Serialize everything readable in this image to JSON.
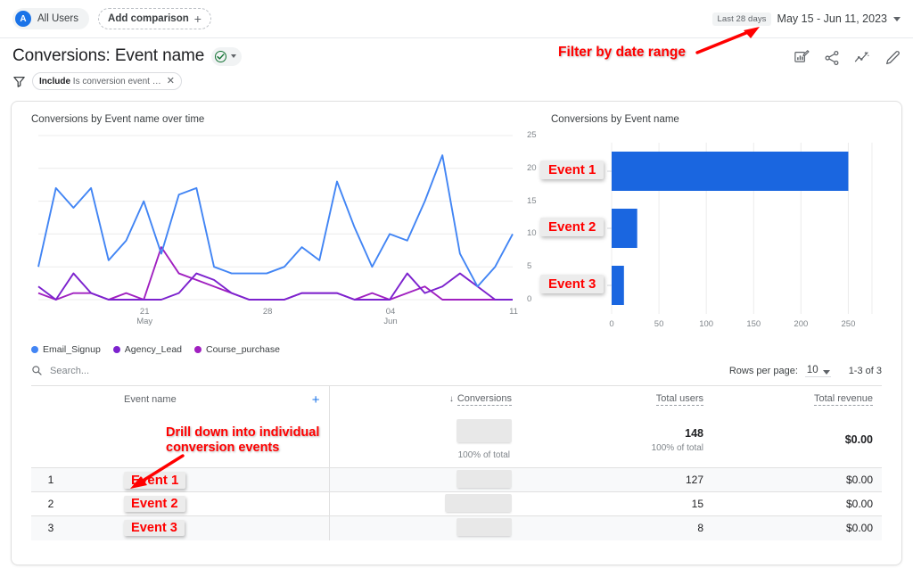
{
  "topbar": {
    "audience_initial": "A",
    "audience_label": "All Users",
    "add_comparison_label": "Add comparison",
    "last_days_badge": "Last 28 days",
    "date_range": "May 15 - Jun 11, 2023"
  },
  "header": {
    "title": "Conversions: Event name",
    "filter_chip_prefix": "Include",
    "filter_chip_text": "Is conversion event …",
    "icons": [
      "insights-icon",
      "share-icon",
      "compare-icon",
      "edit-icon"
    ]
  },
  "annotations": {
    "date_filter": "Filter by date range",
    "drill_down_line1": "Drill down into individual",
    "drill_down_line2": "conversion events",
    "bar_labels": [
      "Event 1",
      "Event 2",
      "Event 3"
    ],
    "row_labels": [
      "Event 1",
      "Event 2",
      "Event 3"
    ],
    "color": "#ff0000"
  },
  "chart_data": [
    {
      "type": "line",
      "title": "Conversions by Event name over time",
      "xlabel": "",
      "ylabel": "",
      "ylim": [
        0,
        25
      ],
      "yticks": [
        0,
        5,
        10,
        15,
        20,
        25
      ],
      "grid": true,
      "legend_position": "bottom-left",
      "x_tick_labels": [
        "21\nMay",
        "28",
        "04\nJun",
        "11"
      ],
      "x_tick_indices": [
        6,
        13,
        20,
        27
      ],
      "x": [
        "May 15",
        "May 16",
        "May 17",
        "May 18",
        "May 19",
        "May 20",
        "May 21",
        "May 22",
        "May 23",
        "May 24",
        "May 25",
        "May 26",
        "May 27",
        "May 28",
        "May 29",
        "May 30",
        "May 31",
        "Jun 01",
        "Jun 02",
        "Jun 03",
        "Jun 04",
        "Jun 05",
        "Jun 06",
        "Jun 07",
        "Jun 08",
        "Jun 09",
        "Jun 10",
        "Jun 11"
      ],
      "series": [
        {
          "name": "Email_Signup",
          "color": "#4285f4",
          "values": [
            5,
            17,
            14,
            17,
            6,
            9,
            15,
            7,
            16,
            17,
            5,
            4,
            4,
            4,
            5,
            8,
            6,
            18,
            11,
            5,
            10,
            9,
            15,
            22,
            7,
            2,
            5,
            10
          ]
        },
        {
          "name": "Agency_Lead",
          "color": "#7c22ce",
          "values": [
            2,
            0,
            4,
            1,
            0,
            0,
            0,
            0,
            1,
            4,
            3,
            1,
            0,
            0,
            0,
            1,
            1,
            1,
            0,
            0,
            0,
            4,
            1,
            2,
            4,
            2,
            0,
            0
          ]
        },
        {
          "name": "Course_purchase",
          "color": "#a020c0",
          "values": [
            1,
            0,
            1,
            1,
            0,
            1,
            0,
            8,
            4,
            3,
            2,
            1,
            0,
            0,
            0,
            1,
            1,
            1,
            0,
            1,
            0,
            1,
            2,
            0,
            0,
            0,
            0,
            0
          ]
        }
      ]
    },
    {
      "type": "bar",
      "orientation": "horizontal",
      "title": "Conversions by Event name",
      "categories": [
        "Event 1",
        "Event 2",
        "Event 3"
      ],
      "values": [
        250,
        27,
        13
      ],
      "bar_color": "#1a66e0",
      "xlim": [
        0,
        275
      ],
      "xticks": [
        0,
        50,
        100,
        150,
        200,
        250
      ],
      "grid": true
    }
  ],
  "table": {
    "search_placeholder": "Search...",
    "rows_per_page_label": "Rows per page:",
    "rows_per_page_value": "10",
    "range_label": "1-3 of 3",
    "columns": [
      {
        "key": "index",
        "label": ""
      },
      {
        "key": "name",
        "label": "Event name"
      },
      {
        "key": "conversions",
        "label": "Conversions",
        "sorted": true
      },
      {
        "key": "users",
        "label": "Total users"
      },
      {
        "key": "revenue",
        "label": "Total revenue"
      }
    ],
    "add_column_glyph": "+",
    "sort_glyph": "↓",
    "totals": {
      "conversions": "",
      "conversions_sub": "100% of total",
      "users": "148",
      "users_sub": "100% of total",
      "revenue": "$0.00"
    },
    "rows": [
      {
        "index": "1",
        "name": "Event 1",
        "conversions": "",
        "users": "127",
        "revenue": "$0.00"
      },
      {
        "index": "2",
        "name": "Event 2",
        "conversions": "",
        "users": "15",
        "revenue": "$0.00"
      },
      {
        "index": "3",
        "name": "Event 3",
        "conversions": "",
        "users": "8",
        "revenue": "$0.00"
      }
    ]
  }
}
